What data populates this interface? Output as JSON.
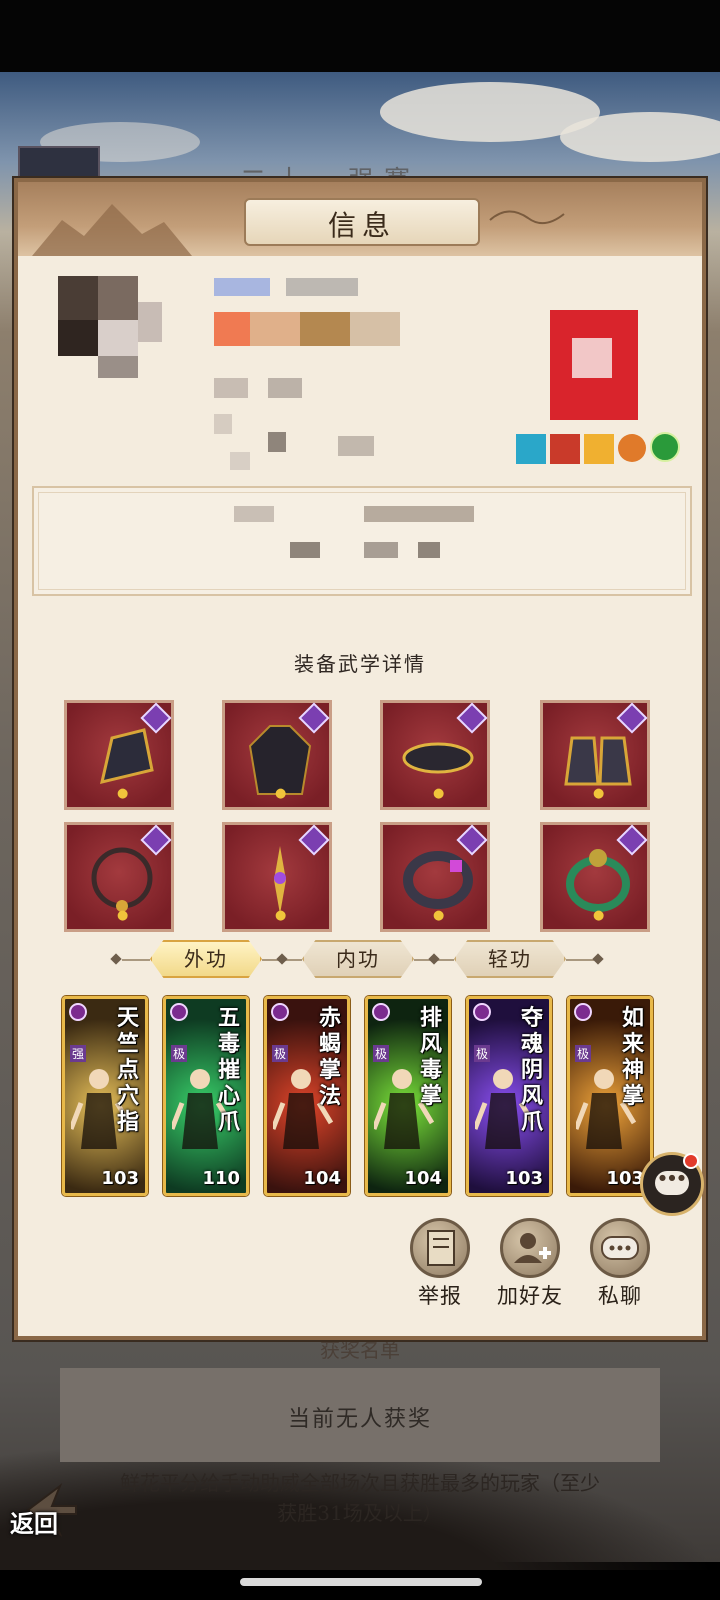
{
  "background": {
    "title": "二十一强赛",
    "list_title": "获奖名单",
    "list_empty": "当前无人获奖",
    "description": "鲜花平分给手动助威全部场次且获胜最多的玩家（至少获胜31场及以上）",
    "back_label": "返回"
  },
  "modal": {
    "title": "信息",
    "section_title": "装备武学详情",
    "equipment": [
      {
        "name": "护腕",
        "icon": "bracer-icon"
      },
      {
        "name": "衣服",
        "icon": "robe-icon"
      },
      {
        "name": "腰带",
        "icon": "belt-icon"
      },
      {
        "name": "鞋子",
        "icon": "boots-icon"
      },
      {
        "name": "项链",
        "icon": "necklace-icon"
      },
      {
        "name": "发簪",
        "icon": "hairpin-icon"
      },
      {
        "name": "戒指",
        "icon": "ring-icon"
      },
      {
        "name": "手镯",
        "icon": "bracelet-icon"
      }
    ],
    "tabs": [
      {
        "label": "外功",
        "active": true
      },
      {
        "label": "内功",
        "active": false
      },
      {
        "label": "轻功",
        "active": false
      }
    ],
    "skills": [
      {
        "name": "天竺点穴指",
        "level": "103",
        "grade": "强",
        "colors": [
          "#3b2a12",
          "#e8c15a"
        ]
      },
      {
        "name": "五毒摧心爪",
        "level": "110",
        "grade": "极",
        "colors": [
          "#0e3b22",
          "#39d16a"
        ]
      },
      {
        "name": "赤蝎掌法",
        "level": "104",
        "grade": "极",
        "colors": [
          "#3a120e",
          "#e0452a"
        ]
      },
      {
        "name": "排风毒掌",
        "level": "104",
        "grade": "极",
        "colors": [
          "#0e2410",
          "#7be33a"
        ]
      },
      {
        "name": "夺魂阴风爪",
        "level": "103",
        "grade": "极",
        "colors": [
          "#1f0f3d",
          "#8a4ff2"
        ]
      },
      {
        "name": "如来神掌",
        "level": "103",
        "grade": "极",
        "colors": [
          "#3a1a08",
          "#f0a43a"
        ]
      }
    ],
    "actions": [
      {
        "label": "举报",
        "icon": "blacklist-book-icon"
      },
      {
        "label": "加好友",
        "icon": "add-friend-icon"
      },
      {
        "label": "私聊",
        "icon": "chat-icon"
      }
    ]
  },
  "colors": {
    "accent_gold": "#e8b94a",
    "equip_bg": "#8a2a30",
    "panel_bg": "#f4ecde"
  }
}
